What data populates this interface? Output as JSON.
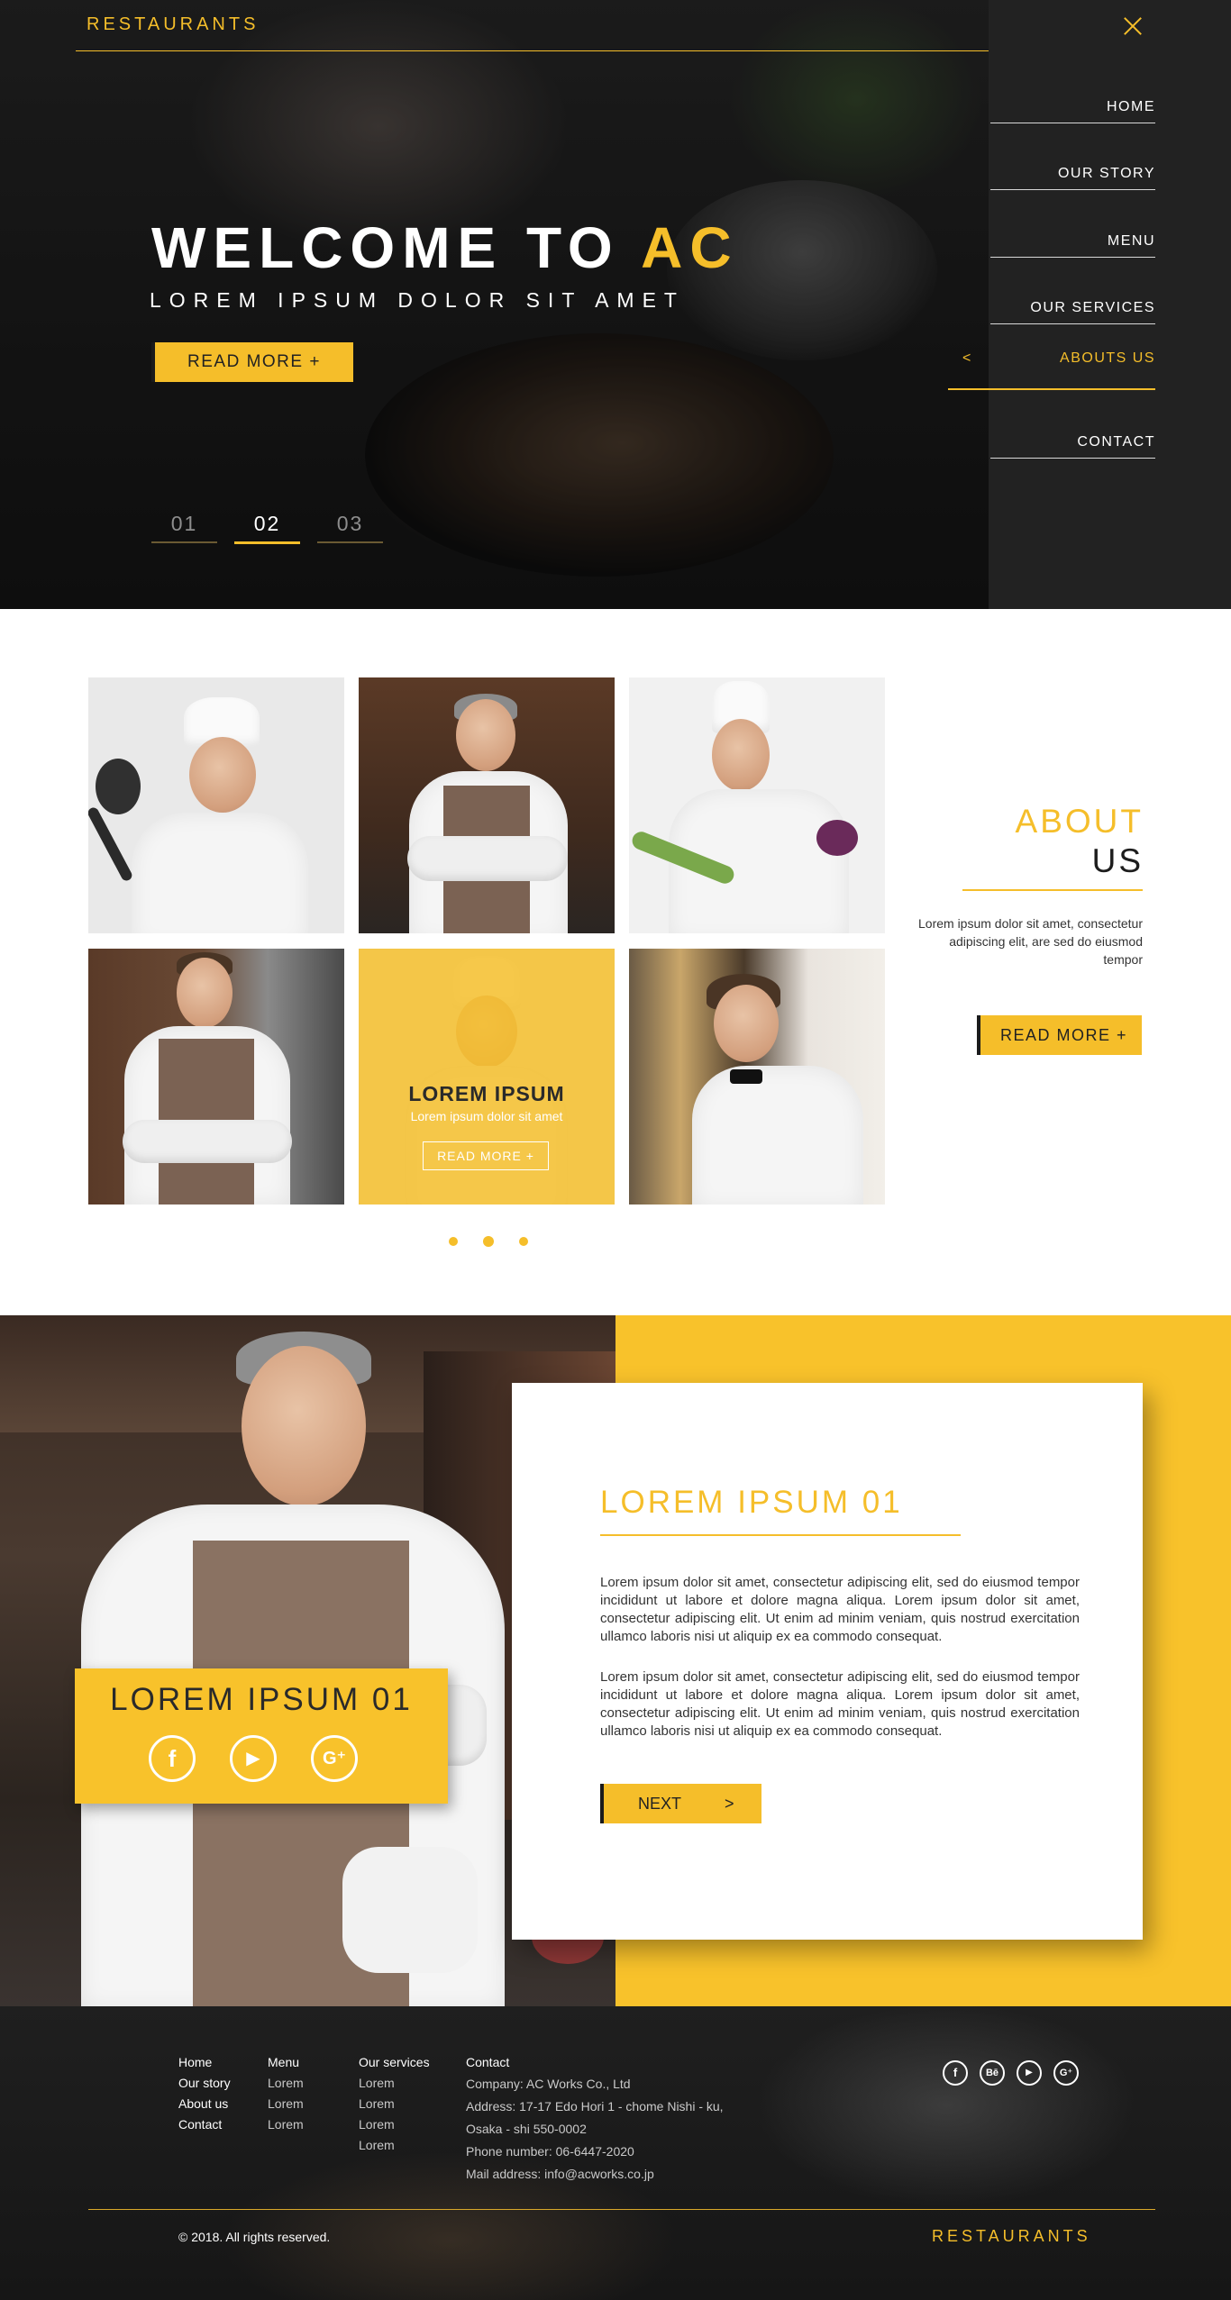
{
  "header": {
    "brand": "RESTAURANTS",
    "close_icon": "close-icon"
  },
  "nav": {
    "items": [
      {
        "label": "HOME",
        "active": false
      },
      {
        "label": "OUR STORY",
        "active": false
      },
      {
        "label": "MENU",
        "active": false
      },
      {
        "label": "OUR SERVICES",
        "active": false
      },
      {
        "label": "ABOUTS US",
        "active": true
      },
      {
        "label": "CONTACT",
        "active": false
      }
    ],
    "active_chevron": "<"
  },
  "hero": {
    "title_main": "WELCOME TO ",
    "title_accent": "AC",
    "subtitle": "LOREM IPSUM DOLOR SIT AMET",
    "button_label": "READ MORE  +",
    "slides": [
      "01",
      "02",
      "03"
    ],
    "active_slide": "02"
  },
  "about": {
    "title_line1": "ABOUT",
    "title_line2": "US",
    "text": "Lorem ipsum dolor sit amet, consectetur adipiscing elit, are sed do eiusmod tempor",
    "button_label": "READ MORE +",
    "overlay": {
      "title": "LOREM IPSUM",
      "subtitle": "Lorem ipsum dolor sit amet",
      "button_label": "READ MORE  +"
    },
    "pagination_dots": 3,
    "active_dot": 2
  },
  "feature": {
    "banner_title": "LOREM IPSUM 01",
    "social": [
      {
        "icon": "facebook-icon",
        "glyph": "f"
      },
      {
        "icon": "play-icon",
        "glyph": "▶"
      },
      {
        "icon": "google-plus-icon",
        "glyph": "G⁺"
      }
    ],
    "card_title": "LOREM IPSUM 01",
    "paragraph1": "Lorem ipsum dolor sit amet, consectetur adipiscing elit, sed do eiusmod tempor incididunt ut labore et dolore magna aliqua. Lorem ipsum dolor sit amet, consectetur adipiscing elit. Ut enim ad minim veniam, quis nostrud exercitation ullamco laboris nisi ut aliquip ex ea commodo consequat.",
    "paragraph2": "Lorem ipsum dolor sit amet, consectetur adipiscing elit, sed do eiusmod tempor incididunt ut labore et dolore magna aliqua. Lorem ipsum dolor sit amet, consectetur adipiscing elit. Ut enim ad minim veniam, quis nostrud exercitation ullamco laboris nisi ut aliquip ex ea commodo consequat.",
    "next_label": "NEXT",
    "next_arrow": ">"
  },
  "footer": {
    "col1": [
      "Home",
      "Our story",
      "About us",
      "Contact"
    ],
    "col2_header": "Menu",
    "col2": [
      "Lorem",
      "Lorem",
      "Lorem"
    ],
    "col3_header": "Our services",
    "col3": [
      "Lorem",
      "Lorem",
      "Lorem",
      "Lorem"
    ],
    "contact_header": "Contact",
    "contact": [
      "Company: AC Works Co., Ltd",
      "Address: 17-17 Edo Hori 1 - chome Nishi - ku,",
      "Osaka - shi 550-0002",
      "Phone number: 06-6447-2020",
      "Mail address: info@acworks.co.jp"
    ],
    "social": [
      {
        "icon": "facebook-icon",
        "glyph": "f"
      },
      {
        "icon": "behance-icon",
        "glyph": "Bē"
      },
      {
        "icon": "play-icon",
        "glyph": "▶"
      },
      {
        "icon": "google-plus-icon",
        "glyph": "G⁺"
      }
    ],
    "copyright": "© 2018. All rights reserved.",
    "brand": "RESTAURANTS"
  },
  "colors": {
    "accent": "#f5be2a",
    "dark": "#222222",
    "text": "#333333"
  }
}
